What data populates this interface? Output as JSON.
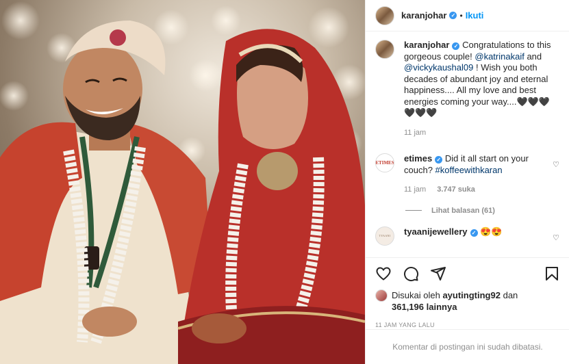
{
  "header": {
    "username": "karanjohar",
    "separator": "•",
    "follow_label": "Ikuti"
  },
  "caption": {
    "username": "karanjohar",
    "text_1": "Congratulations to this gorgeous couple!",
    "mention_1": "@katrinakaif",
    "text_2": "and",
    "mention_2": "@vickykaushal09",
    "text_3": "! Wish you both decades of abundant joy and eternal happiness.... All my love and best energies coming your way....🖤🖤🖤🖤🖤🖤",
    "time": "11 jam"
  },
  "comments": [
    {
      "username": "etimes",
      "avatar_text": "ETIMES",
      "text": "Did it all start on your couch?",
      "hashtag": "#koffeewithkaran",
      "time": "11 jam",
      "likes": "3.747 suka",
      "replies": "Lihat balasan (61)"
    },
    {
      "username": "tyaanijewellery",
      "avatar_text": "TYAANI",
      "text": "😍😍"
    }
  ],
  "likes": {
    "prefix": "Disukai oleh",
    "user": "ayutingting92",
    "mid": "dan",
    "count": "361,196",
    "suffix": "lainnya"
  },
  "posted_ago": "11 JAM YANG LALU",
  "comments_disabled": "Komentar di postingan ini sudah dibatasi.",
  "icons": [
    "like-icon",
    "comment-icon",
    "share-icon",
    "bookmark-icon"
  ]
}
